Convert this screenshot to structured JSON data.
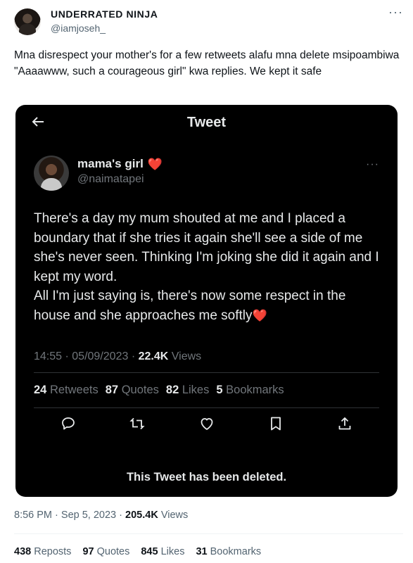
{
  "outer_tweet": {
    "author_name": "UNDERRATED NINJA",
    "author_handle": "@iamjoseh_",
    "more_label": "···",
    "text": "Mna disrespect your mother's for a few retweets alafu mna delete msipoambiwa \"Aaaawww, such a courageous girl\" kwa replies. We kept it safe",
    "time": "8:56 PM",
    "date": "Sep 5, 2023",
    "views": "205.4K",
    "views_label": "Views",
    "sep": "·",
    "stats": {
      "reposts": "438",
      "reposts_label": "Reposts",
      "quotes": "97",
      "quotes_label": "Quotes",
      "likes": "845",
      "likes_label": "Likes",
      "bookmarks": "31",
      "bookmarks_label": "Bookmarks"
    }
  },
  "embedded": {
    "header_title": "Tweet",
    "author_name": "mama's girl",
    "name_emoji": "❤️",
    "author_handle": "@naimatapei",
    "more_label": "···",
    "text": "There's a day my mum shouted at me and I placed a boundary that if she tries it again she'll see a side of me she's never seen. Thinking I'm joking she did it again and I kept my word.\nAll I'm just saying is, there's now some respect in the house and she approaches me softly",
    "text_emoji": "❤️",
    "time": "14:55",
    "date": "05/09/2023",
    "views": "22.4K",
    "views_label": "Views",
    "sep": "·",
    "stats": {
      "retweets": "24",
      "retweets_label": "Retweets",
      "quotes": "87",
      "quotes_label": "Quotes",
      "likes": "82",
      "likes_label": "Likes",
      "bookmarks": "5",
      "bookmarks_label": "Bookmarks"
    },
    "actions": [
      "reply-icon",
      "retweet-icon",
      "like-icon",
      "bookmark-icon",
      "share-icon"
    ],
    "deleted_notice": "This Tweet has been deleted."
  },
  "colors": {
    "card_bg": "#000000",
    "text_dark": "#e7e9ea",
    "muted_dark": "#71767b",
    "text_light": "#0f1419",
    "muted_light": "#536471",
    "heart": "#e0245e"
  }
}
